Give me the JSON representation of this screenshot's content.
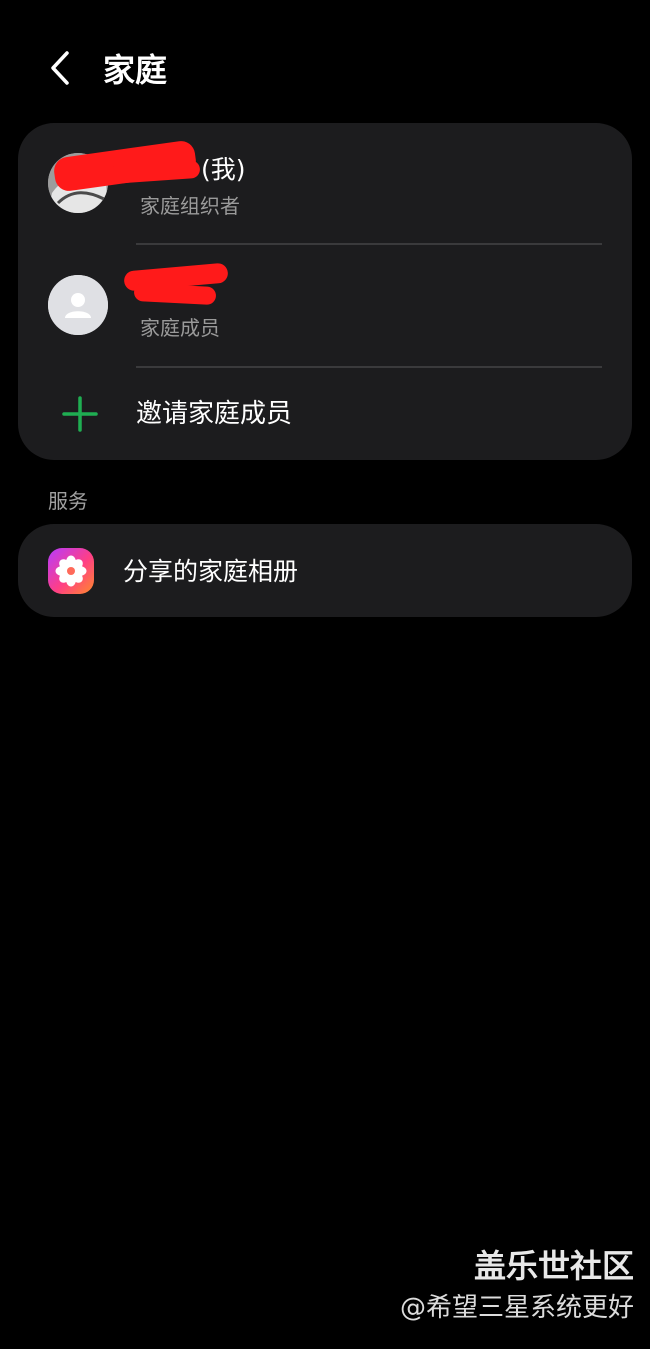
{
  "header": {
    "title": "家庭",
    "back_icon": "chevron-left-icon"
  },
  "family": {
    "members": [
      {
        "name_suffix": "(我)",
        "role": "家庭组织者",
        "avatar": "avatar-photo"
      },
      {
        "name_suffix": "",
        "role": "家庭成员",
        "avatar": "default-person-avatar"
      }
    ],
    "invite_label": "邀请家庭成员",
    "invite_icon": "plus-icon",
    "invite_color": "#1fae52"
  },
  "services": {
    "section_title": "服务",
    "items": [
      {
        "label": "分享的家庭相册",
        "icon": "gallery-flower-icon"
      }
    ]
  },
  "watermark": {
    "main": "盖乐世社区",
    "sub": "@希望三星系统更好"
  },
  "colors": {
    "background": "#000000",
    "card": "#1c1c1e",
    "redaction": "#ff1a1a"
  }
}
